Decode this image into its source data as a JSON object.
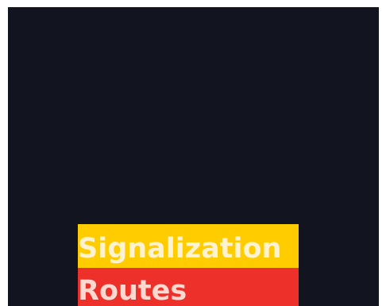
{
  "menu": {
    "items": [
      {
        "label": "Signalization"
      },
      {
        "label": "Routes"
      }
    ]
  },
  "colors": {
    "background": "#121520",
    "signalization_bg": "#ffcc00",
    "signalization_text": "#fff2d0",
    "routes_bg": "#ee302b",
    "routes_text": "#ffd9cf"
  }
}
